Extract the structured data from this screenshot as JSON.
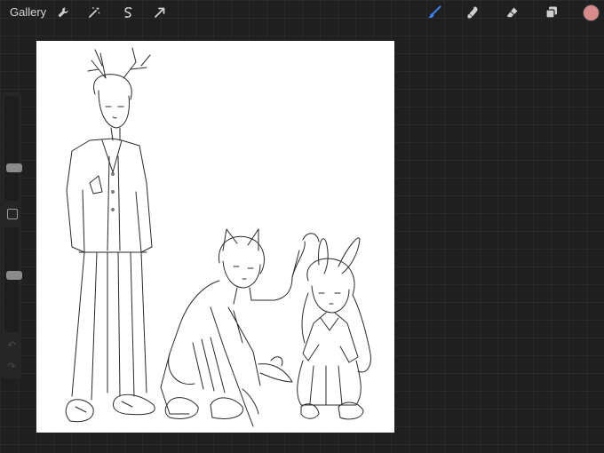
{
  "toolbar": {
    "gallery_label": "Gallery",
    "left_tools": [
      "wrench-icon",
      "magic-wand-icon",
      "selection-icon",
      "transform-arrow-icon"
    ],
    "right_tools": [
      "brush-icon",
      "smudge-icon",
      "eraser-icon",
      "layers-icon"
    ],
    "active_tool": "brush-icon",
    "active_color": "#d98a8a",
    "accent": "#3b82f6"
  },
  "sidebar": {
    "brush_size_level": 0.3,
    "opacity_level": 0.55,
    "controls": [
      "brush-size-slider",
      "modify-button",
      "opacity-slider",
      "undo-icon",
      "redo-icon"
    ]
  },
  "canvas": {
    "content": "line-art-illustration",
    "background": "#ffffff"
  }
}
